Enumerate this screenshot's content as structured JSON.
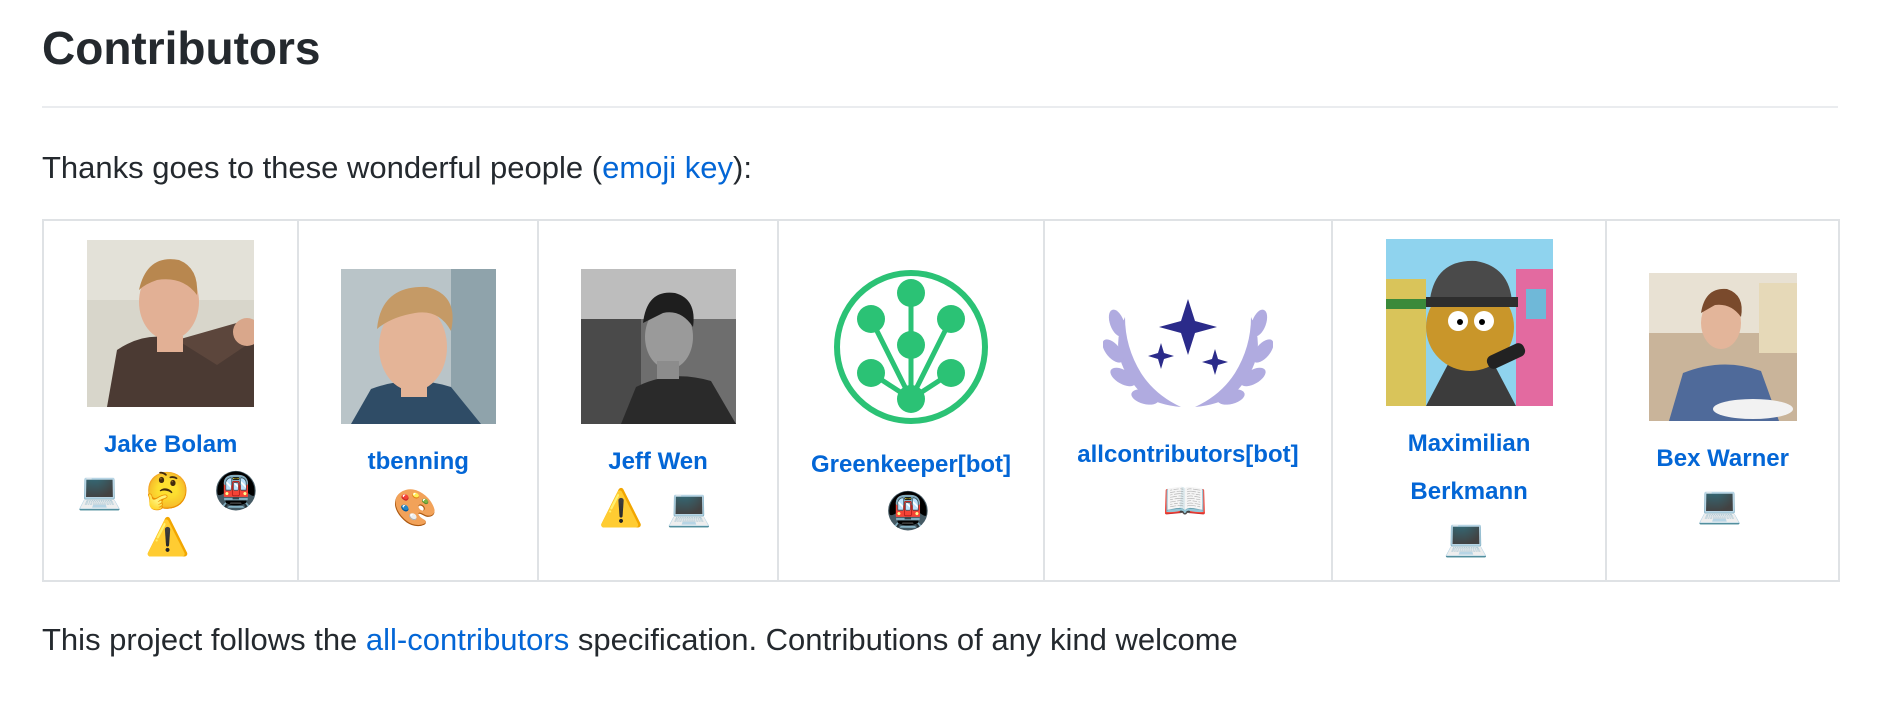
{
  "heading": "Contributors",
  "intro": {
    "prefix": "Thanks goes to these wonderful people (",
    "link": "emoji key",
    "suffix": "):"
  },
  "contributors": [
    {
      "name": "Jake Bolam",
      "emojis": "💻 🤔 🚇 ⚠️"
    },
    {
      "name": "tbenning",
      "emojis": "🎨"
    },
    {
      "name": "Jeff Wen",
      "emojis": "⚠️ 💻"
    },
    {
      "name": "Greenkeeper[bot]",
      "emojis": "🚇"
    },
    {
      "name": "allcontributors[bot]",
      "emojis": "📖"
    },
    {
      "name": "Maximilian Berkmann",
      "emojis": "💻"
    },
    {
      "name": "Bex Warner",
      "emojis": "💻"
    }
  ],
  "outro": {
    "prefix": "This project follows the ",
    "link": "all-contributors",
    "suffix": " specification. Contributions of any kind welcome"
  },
  "colors": {
    "link": "#0366d6",
    "text": "#24292e",
    "border": "#dfe2e5",
    "greenkeeper": "#2bc275",
    "allcontributors": "#b0abe0",
    "allcontributors_star": "#2b2b8a"
  }
}
